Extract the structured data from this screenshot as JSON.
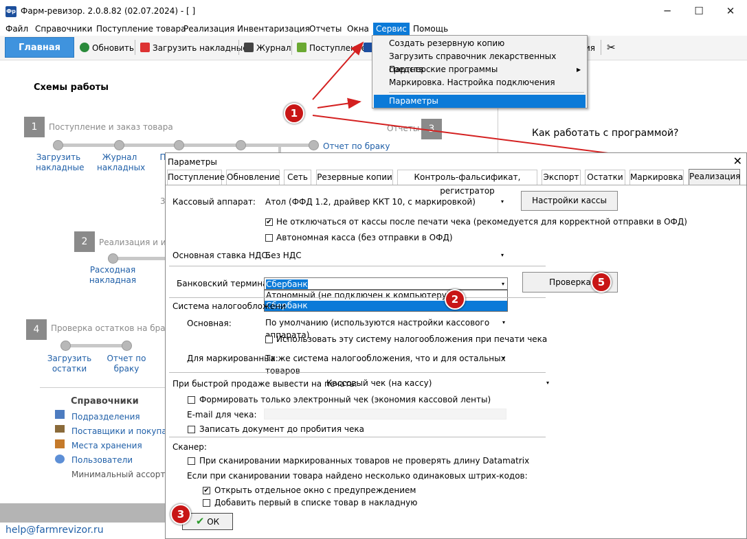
{
  "window": {
    "title": "Фарм-ревизор. 2.0.8.82 (02.07.2024) - [ ]",
    "icon": "Фр",
    "minimize": "─",
    "maximize": "☐",
    "close": "✕"
  },
  "menu": [
    "Файл",
    "Справочники",
    "Поступление товара",
    "Реализация",
    "Инвентаризация",
    "Отчеты",
    "Окна",
    "Сервис",
    "Помощь"
  ],
  "toolbar": {
    "main_tab": "Главная",
    "buttons": [
      "Обновить",
      "Загрузить накладные",
      "Журнал",
      "Поступление"
    ],
    "partial_right": "ия"
  },
  "service_menu": {
    "items": [
      "Создать резервную копию",
      "Загрузить справочник лекарственных средств",
      "Партнерские программы",
      "Маркировка. Настройка подключения",
      "Параметры"
    ],
    "submenu_arrow": "▶"
  },
  "schema": {
    "title": "Схемы работы",
    "step1": {
      "num": "1",
      "label": "Поступление и заказ товара",
      "link1": "Загрузить накладные",
      "link2": "Журнал накладных",
      "link3_partial": "П",
      "report_link": "Отчет по браку"
    },
    "step3": {
      "num": "3",
      "label": "Отчеты"
    },
    "partial_3": "3",
    "step2": {
      "num": "2",
      "label": "Реализация и и",
      "link1": "Расходная накладная"
    },
    "step4": {
      "num": "4",
      "label": "Проверка остатков на брак",
      "link1": "Загрузить остатки",
      "link2": "Отчет по браку"
    },
    "how_to": "Как работать с программой?"
  },
  "directories": {
    "title": "Справочники",
    "items": [
      "Подразделения",
      "Поставщики и покупате",
      "Места хранения",
      "Пользователи"
    ],
    "extra": "Минимальный ассортим"
  },
  "email": "help@farmrevizor.ru",
  "dialog": {
    "title": "Параметры",
    "close": "✕",
    "tabs": [
      "Поступление",
      "Обновление",
      "Сеть",
      "Резервные копии",
      "Контроль-фальсификат, регистратор",
      "Экспорт",
      "Остатки",
      "Маркировка",
      "Реализация"
    ],
    "kkt_label": "Кассовый аппарат:",
    "kkt_value": "Атол (ФФД 1.2, драйвер ККТ 10, с маркировкой)",
    "kkt_settings_btn": "Настройки кассы",
    "chk_no_disconnect": "Не отключаться от кассы после печати чека (рекомедуется для корректной отправки в ОФД)",
    "chk_autonomous": "Автономная касса (без отправки в ОФД)",
    "vat_label": "Основная ставка НДС:",
    "vat_value": "Без НДС",
    "bank_label": "Банковский терминал:",
    "bank_value": "Сбербанк",
    "bank_options": [
      "Атономный (не подключен к компьютеру)",
      "Сбербанк"
    ],
    "check_btn": "Проверка",
    "tax_title": "Система налогообложени",
    "tax_main_label": "Основная:",
    "tax_main_value": "По умолчанию (используются настройки кассового аппарата)",
    "chk_use_tax": "Использовать эту систему налогообложения при печати чека",
    "tax_marked_label": "Для маркированных:",
    "tax_marked_value": "Та же система налогообложения, что и для остальных товаров",
    "fast_sale_label": "При быстрой продаже вывести на печать:",
    "fast_sale_value": "Кассовый чек (на кассу)",
    "chk_electronic": "Формировать только электронный чек (экономия кассовой ленты)",
    "email_label": "E-mail для чека:",
    "chk_save_doc": "Записать документ до пробития чека",
    "scanner_label": "Сканер:",
    "chk_datamatrix": "При сканировании маркированных товаров не проверять длину Datamatrix",
    "dup_label": "Если при сканировании товара найдено несколько одинаковых штрих-кодов:",
    "chk_open_window": "Открыть отдельное окно с предупреждением",
    "chk_add_first": "Добавить первый в списке товар в накладную",
    "ok_btn": "ОК",
    "check_mark": "✔",
    "arrow": "▾"
  },
  "badges": [
    "1",
    "2",
    "3",
    "5"
  ],
  "colors": {
    "accent": "#0b7ad8",
    "badge": "#c81616",
    "arrow": "#d42020",
    "link": "#1f5fa8"
  }
}
